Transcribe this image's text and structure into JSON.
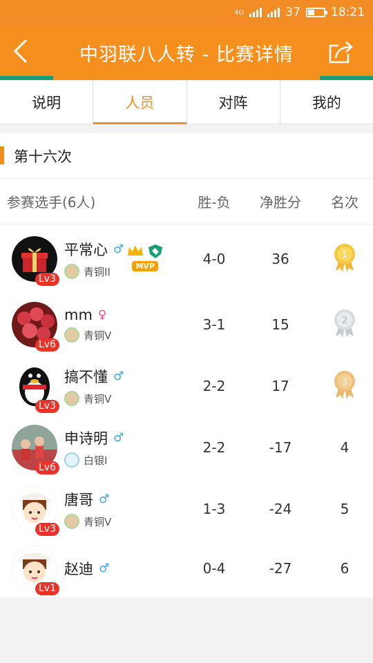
{
  "status": {
    "network": "4G",
    "battery": "37",
    "time": "18:21"
  },
  "header": {
    "title": "中羽联八人转 - 比赛详情"
  },
  "tabs": [
    "说明",
    "人员",
    "对阵",
    "我的"
  ],
  "section": {
    "title": "第十六次"
  },
  "table": {
    "headers": {
      "players": "参赛选手(6人)",
      "win_loss": "胜-负",
      "net_score": "净胜分",
      "rank": "名次"
    }
  },
  "players": [
    {
      "name": "平常心",
      "gender": "♂",
      "level": "Lv3",
      "rank_title": "青铜II",
      "win_loss": "4-0",
      "net": "36",
      "place": "1",
      "mvp": "MVP"
    },
    {
      "name": "mm",
      "gender": "♀",
      "level": "Lv6",
      "rank_title": "青铜V",
      "win_loss": "3-1",
      "net": "15",
      "place": "2"
    },
    {
      "name": "搞不懂",
      "gender": "♂",
      "level": "Lv3",
      "rank_title": "青铜V",
      "win_loss": "2-2",
      "net": "17",
      "place": "3"
    },
    {
      "name": "申诗明",
      "gender": "♂",
      "level": "Lv6",
      "rank_title": "白银I",
      "win_loss": "2-2",
      "net": "-17",
      "place": "4"
    },
    {
      "name": "唐哥",
      "gender": "♂",
      "level": "Lv3",
      "rank_title": "青铜V",
      "win_loss": "1-3",
      "net": "-24",
      "place": "5"
    },
    {
      "name": "赵迪",
      "gender": "♂",
      "level": "Lv1",
      "rank_title": "",
      "win_loss": "0-4",
      "net": "-27",
      "place": "6"
    }
  ],
  "colors": {
    "primary": "#f28c24",
    "accent": "#1a9e77",
    "level_badge": "#e8332a"
  }
}
